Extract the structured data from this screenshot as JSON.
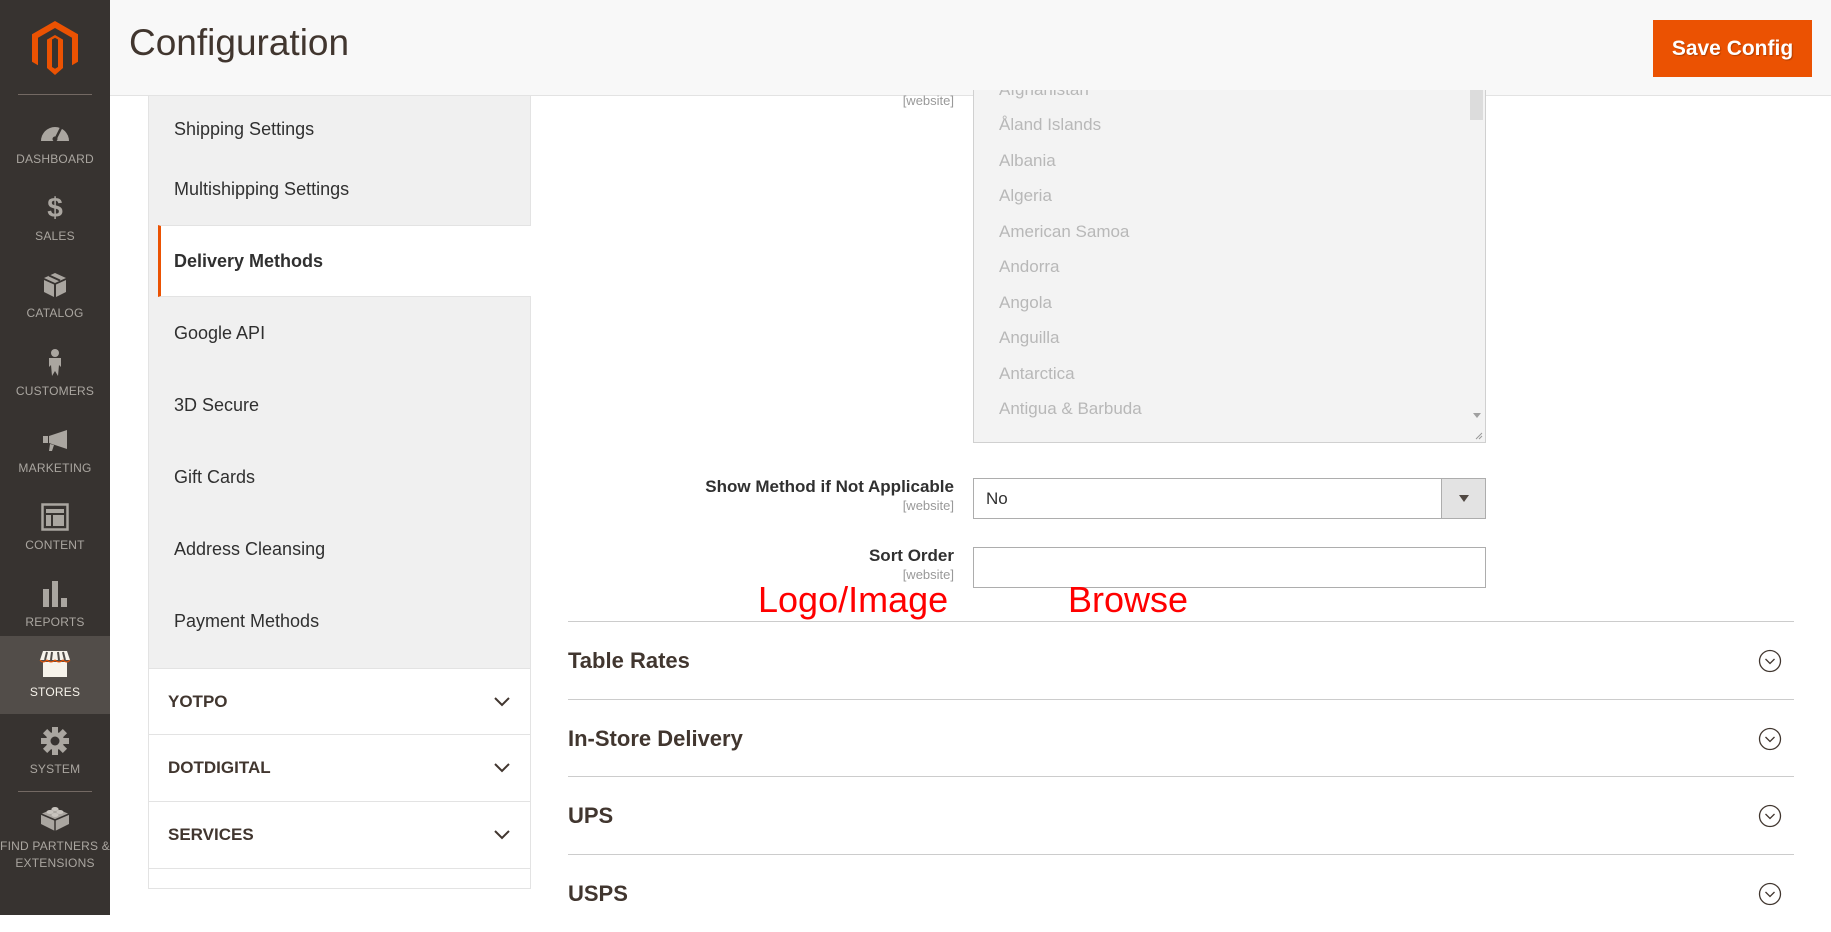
{
  "admin_menu": {
    "items": [
      {
        "label": "Dashboard",
        "icon": "dashboard-icon"
      },
      {
        "label": "Sales",
        "icon": "dollar-icon"
      },
      {
        "label": "Catalog",
        "icon": "box-icon"
      },
      {
        "label": "Customers",
        "icon": "person-icon"
      },
      {
        "label": "Marketing",
        "icon": "megaphone-icon"
      },
      {
        "label": "Content",
        "icon": "layout-icon"
      },
      {
        "label": "Reports",
        "icon": "bar-chart-icon"
      },
      {
        "label": "Stores",
        "icon": "storefront-icon",
        "active": true
      },
      {
        "label": "System",
        "icon": "gear-icon"
      },
      {
        "label": "Find Partners & Extensions",
        "icon": "lego-brick-icon"
      }
    ],
    "colors": {
      "background": "#373330",
      "active": "#524d49",
      "brand": "#eb5202"
    }
  },
  "header": {
    "title": "Configuration",
    "save_label": "Save Config"
  },
  "config_nav": {
    "items": [
      {
        "label": "Shipping Settings"
      },
      {
        "label": "Multishipping Settings"
      },
      {
        "label": "Delivery Methods",
        "active": true
      },
      {
        "label": "Google API"
      },
      {
        "label": "3D Secure"
      },
      {
        "label": "Gift Cards"
      },
      {
        "label": "Address Cleansing"
      },
      {
        "label": "Payment Methods"
      }
    ],
    "sections": [
      {
        "label": "YOTPO"
      },
      {
        "label": "DOTDIGITAL"
      },
      {
        "label": "SERVICES"
      }
    ]
  },
  "form": {
    "countries_scope": "[website]",
    "countries": [
      "Afghanistan",
      "Åland Islands",
      "Albania",
      "Algeria",
      "American Samoa",
      "Andorra",
      "Angola",
      "Anguilla",
      "Antarctica",
      "Antigua & Barbuda"
    ],
    "show_method": {
      "label": "Show Method if Not Applicable",
      "scope": "[website]",
      "value": "No"
    },
    "sort_order": {
      "label": "Sort Order",
      "scope": "[website]",
      "value": ""
    }
  },
  "annotations": {
    "logo_image": "Logo/Image",
    "browse": "Browse"
  },
  "sections": [
    {
      "title": "Table Rates"
    },
    {
      "title": "In-Store Delivery"
    },
    {
      "title": "UPS"
    },
    {
      "title": "USPS"
    }
  ]
}
